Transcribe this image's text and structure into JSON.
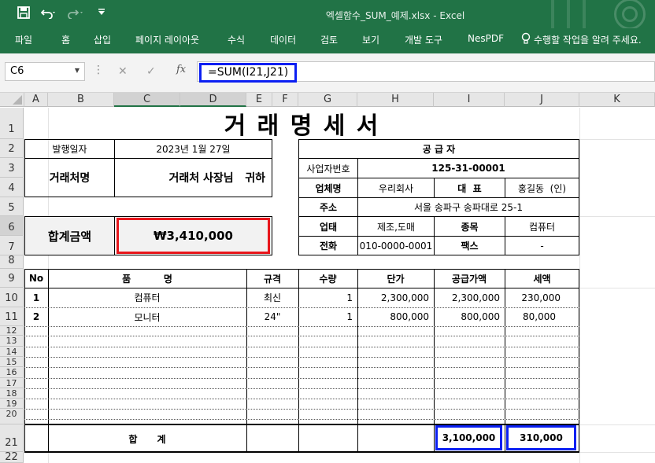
{
  "window": {
    "title": "엑셀함수_SUM_예제.xlsx  -  Excel",
    "qa_save_icon": "save-icon",
    "qa_undo_icon": "undo-icon",
    "qa_redo_icon": "redo-icon"
  },
  "ribbon": {
    "tabs": [
      "파일",
      "홈",
      "삽입",
      "페이지 레이아웃",
      "수식",
      "데이터",
      "검토",
      "보기",
      "개발 도구",
      "NesPDF"
    ],
    "tell_me": "수행할 작업을 알려 주세요."
  },
  "formula_bar": {
    "name_box": "C6",
    "formula": "=SUM(I21,J21)"
  },
  "columns": [
    "A",
    "B",
    "C",
    "D",
    "E",
    "F",
    "G",
    "H",
    "I",
    "J",
    "K"
  ],
  "rows": [
    "1",
    "2",
    "3",
    "4",
    "5",
    "6",
    "7",
    "8",
    "9",
    "10",
    "11",
    "12",
    "13",
    "14",
    "15",
    "16",
    "17",
    "18",
    "19",
    "20",
    "21",
    "22"
  ],
  "invoice": {
    "title": "거 래 명 세 서",
    "issue_label": "발행일자",
    "issue_date": "2023년 1월 27일",
    "client_label": "거래처명",
    "client_name": "거래처 사장님   귀하",
    "total_label": "합계금액",
    "total_amount": "₩3,410,000",
    "supplier_header": "공 급 자",
    "biz_no_label": "사업자번호",
    "biz_no": "125-31-00001",
    "company_label": "업체명",
    "company": "우리회사",
    "rep_label": "대  표",
    "rep": "홍길동  (인)",
    "address_label": "주소",
    "address": "서울 송파구 송파대로 25-1",
    "business_label": "업태",
    "business": "제조,도매",
    "category_label": "종목",
    "category": "컴퓨터",
    "phone_label": "전화",
    "phone": "010-0000-0001",
    "fax_label": "팩스",
    "fax": "-"
  },
  "items_table": {
    "headers": {
      "no": "No",
      "item": "품          명",
      "spec": "규격",
      "qty": "수량",
      "price": "단가",
      "supply": "공급가액",
      "tax": "세액"
    },
    "rows": [
      {
        "no": "1",
        "item": "컴퓨터",
        "spec": "최신",
        "qty": "1",
        "price": "2,300,000",
        "supply": "2,300,000",
        "tax": "230,000"
      },
      {
        "no": "2",
        "item": "모니터",
        "spec": "24\"",
        "qty": "1",
        "price": "800,000",
        "supply": "800,000",
        "tax": "80,000"
      }
    ],
    "total_label": "합      계",
    "total_supply": "3,100,000",
    "total_tax": "310,000"
  }
}
